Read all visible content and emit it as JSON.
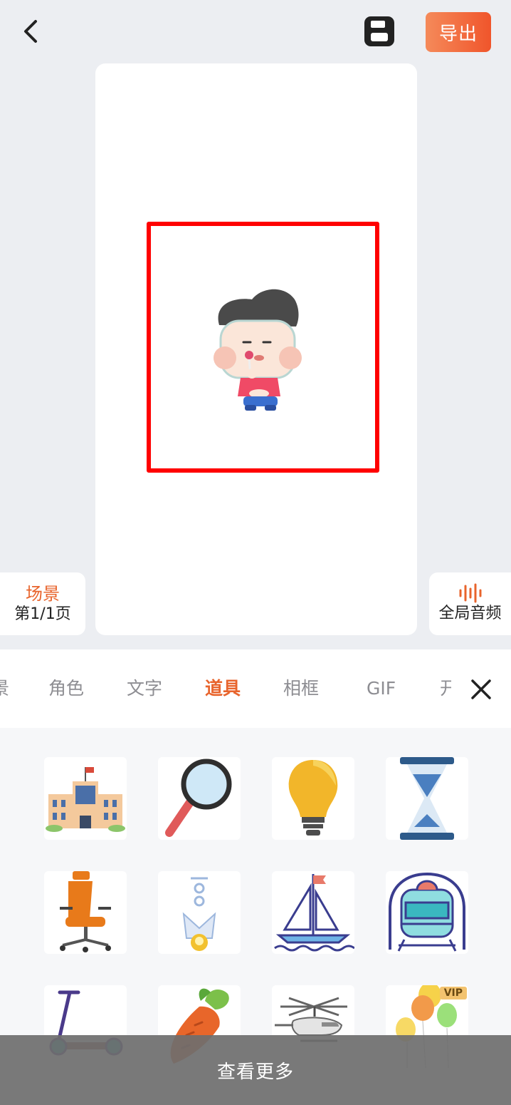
{
  "header": {
    "export_label": "导出"
  },
  "scene": {
    "title": "场景",
    "page_info": "第1/1页"
  },
  "audio": {
    "label": "全局音频"
  },
  "tabs": [
    {
      "label": "景"
    },
    {
      "label": "角色"
    },
    {
      "label": "文字"
    },
    {
      "label": "道具",
      "active": true
    },
    {
      "label": "相框"
    },
    {
      "label": "GIF"
    },
    {
      "label": "开"
    }
  ],
  "props": {
    "items": [
      {
        "name": "building-icon"
      },
      {
        "name": "magnifier-icon"
      },
      {
        "name": "lightbulb-icon"
      },
      {
        "name": "hourglass-icon"
      },
      {
        "name": "office-chair-icon"
      },
      {
        "name": "rocket-icon"
      },
      {
        "name": "sailboat-icon"
      },
      {
        "name": "train-icon"
      },
      {
        "name": "scooter-icon"
      },
      {
        "name": "carrot-icon"
      },
      {
        "name": "helicopter-icon"
      },
      {
        "name": "balloons-icon",
        "badge": "VIP"
      }
    ],
    "more_label": "查看更多"
  },
  "colors": {
    "accent": "#e8642c",
    "export_gradient": [
      "#f58a5a",
      "#f0552b"
    ],
    "selection": "#ff0000"
  }
}
